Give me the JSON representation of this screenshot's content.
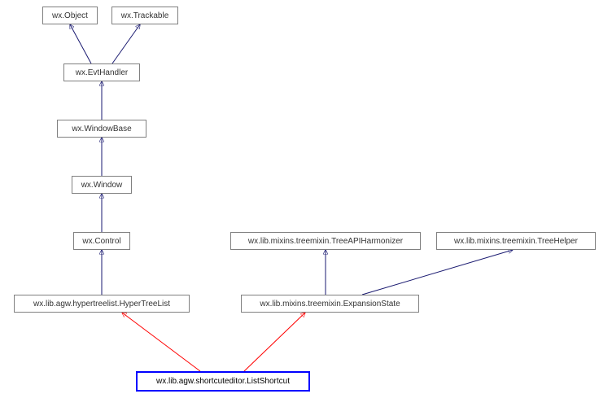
{
  "nodes": [
    {
      "label": "wx.Object"
    },
    {
      "label": "wx.Trackable"
    },
    {
      "label": "wx.EvtHandler"
    },
    {
      "label": "wx.WindowBase"
    },
    {
      "label": "wx.Window"
    },
    {
      "label": "wx.Control"
    },
    {
      "label": "wx.lib.mixins.treemixin.TreeAPIHarmonizer"
    },
    {
      "label": "wx.lib.mixins.treemixin.TreeHelper"
    },
    {
      "label": "wx.lib.agw.hypertreelist.HyperTreeList"
    },
    {
      "label": "wx.lib.mixins.treemixin.ExpansionState"
    },
    {
      "label": "wx.lib.agw.shortcuteditor.ListShortcut"
    }
  ],
  "edges": [
    {
      "from": "wx.EvtHandler",
      "to": "wx.Object"
    },
    {
      "from": "wx.EvtHandler",
      "to": "wx.Trackable"
    },
    {
      "from": "wx.WindowBase",
      "to": "wx.EvtHandler"
    },
    {
      "from": "wx.Window",
      "to": "wx.WindowBase"
    },
    {
      "from": "wx.Control",
      "to": "wx.Window"
    },
    {
      "from": "wx.lib.agw.hypertreelist.HyperTreeList",
      "to": "wx.Control"
    },
    {
      "from": "wx.lib.mixins.treemixin.ExpansionState",
      "to": "wx.lib.mixins.treemixin.TreeAPIHarmonizer"
    },
    {
      "from": "wx.lib.mixins.treemixin.ExpansionState",
      "to": "wx.lib.mixins.treemixin.TreeHelper"
    },
    {
      "from": "wx.lib.agw.shortcuteditor.ListShortcut",
      "to": "wx.lib.agw.hypertreelist.HyperTreeList"
    },
    {
      "from": "wx.lib.agw.shortcuteditor.ListShortcut",
      "to": "wx.lib.mixins.treemixin.ExpansionState"
    }
  ],
  "highlight": "wx.lib.agw.shortcuteditor.ListShortcut"
}
